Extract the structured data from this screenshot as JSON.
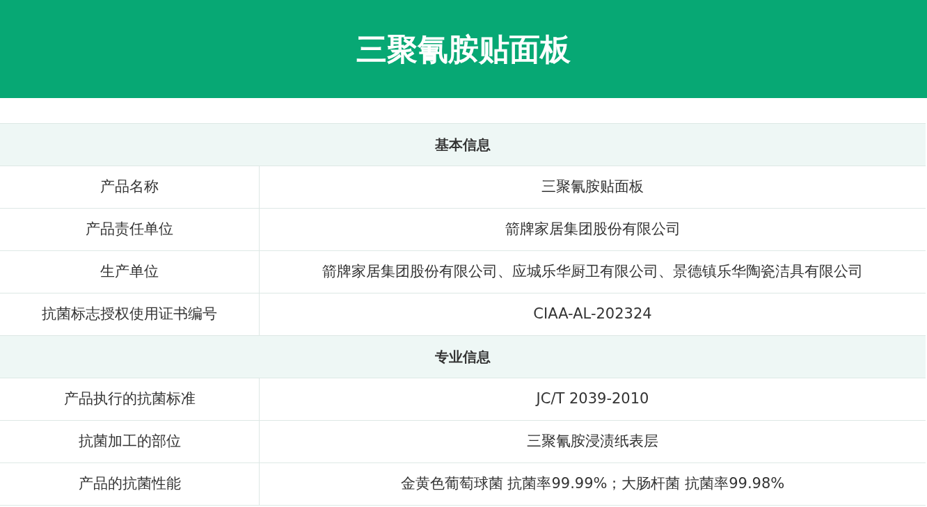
{
  "header": {
    "title": "三聚氰胺贴面板"
  },
  "sections": [
    {
      "title": "基本信息",
      "rows": [
        {
          "label": "产品名称",
          "value": "三聚氰胺贴面板"
        },
        {
          "label": "产品责任单位",
          "value": "箭牌家居集团股份有限公司"
        },
        {
          "label": "生产单位",
          "value": "箭牌家居集团股份有限公司、应城乐华厨卫有限公司、景德镇乐华陶瓷洁具有限公司"
        },
        {
          "label": "抗菌标志授权使用证书编号",
          "value": "CIAA-AL-202324"
        }
      ]
    },
    {
      "title": "专业信息",
      "rows": [
        {
          "label": "产品执行的抗菌标准",
          "value": "JC/T 2039-2010"
        },
        {
          "label": "抗菌加工的部位",
          "value": "三聚氰胺浸渍纸表层"
        },
        {
          "label": "产品的抗菌性能",
          "value": "金黄色葡萄球菌 抗菌率99.99%；大肠杆菌 抗菌率99.98%"
        }
      ]
    }
  ]
}
